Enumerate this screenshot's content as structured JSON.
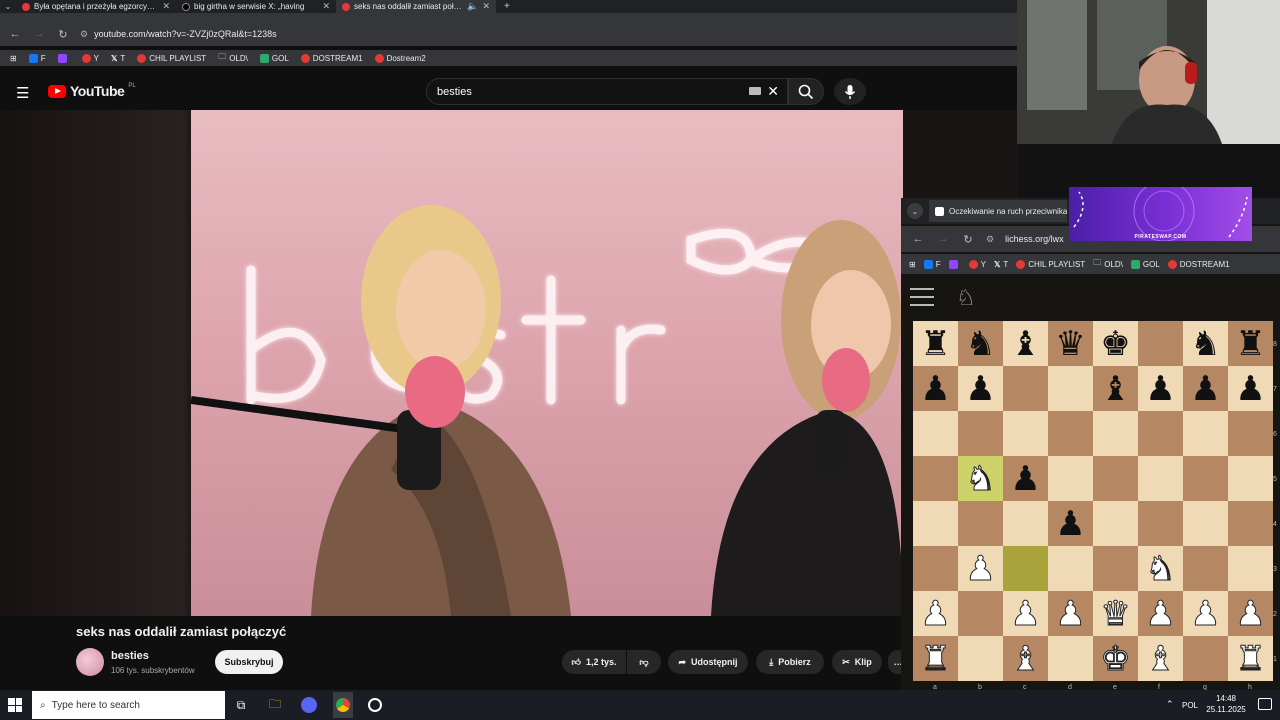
{
  "browser": {
    "tabs": [
      {
        "label": "Była opętana i przeżyła egzorcyzmy",
        "icon": "youtube-icon"
      },
      {
        "label": "big girtha w serwisie X: „having",
        "icon": "x-icon"
      },
      {
        "label": "seks nas oddalił zamiast połączyć",
        "icon": "youtube-icon",
        "active": true
      }
    ],
    "url": "youtube.com/watch?v=-ZVZj0zQRal&t=1238s",
    "bookmarks": [
      "F",
      "",
      "Y",
      "T",
      "CHIL PLAYLIST",
      "OLD\\",
      "GOL",
      "DOSTREAM1",
      "Dostream2"
    ]
  },
  "youtube": {
    "logo": "YouTube",
    "region": "PL",
    "search_value": "besties",
    "video_title": "seks nas oddalił zamiast połączyć",
    "channel_name": "besties",
    "channel_subs": "106 tys. subskrybentów",
    "subscribe_label": "Subskrybuj",
    "like_count": "1,2 tys.",
    "share_label": "Udostępnij",
    "download_label": "Pobierz",
    "clip_label": "Klip",
    "more_label": "…"
  },
  "lichess": {
    "tab_title": "Oczekiwanie na ruch przeciwnika",
    "url": "lichess.org/lwx",
    "bookmarks": [
      "F",
      "",
      "Y",
      "T",
      "CHIL PLAYLIST",
      "OLD\\",
      "GOL",
      "DOSTREAM1"
    ],
    "banner_text": "PIRATESWAP.COM",
    "ranks": [
      "8",
      "7",
      "6",
      "5",
      "4",
      "3",
      "2",
      "1"
    ],
    "files": [
      "a",
      "b",
      "c",
      "d",
      "e",
      "f",
      "g",
      "h"
    ],
    "board": [
      [
        "br",
        "bn",
        "bb",
        "bq",
        "bk",
        "",
        "bn",
        "br"
      ],
      [
        "bp",
        "bp",
        "",
        "",
        "bb",
        "bp",
        "bp",
        "bp"
      ],
      [
        "",
        "",
        "",
        "",
        "",
        "",
        "",
        ""
      ],
      [
        "",
        "wn",
        "bp",
        "",
        "",
        "",
        "",
        ""
      ],
      [
        "",
        "",
        "",
        "bp",
        "",
        "",
        "",
        ""
      ],
      [
        "",
        "wp",
        "",
        "",
        "",
        "wn",
        "",
        ""
      ],
      [
        "wp",
        "",
        "wp",
        "wp",
        "wq",
        "wp",
        "wp",
        "wp"
      ],
      [
        "wr",
        "",
        "wb",
        "",
        "wk",
        "wb",
        "",
        "wr"
      ]
    ],
    "highlights": [
      "b5",
      "c3"
    ]
  },
  "taskbar": {
    "search_placeholder": "Type here to search",
    "lang": "POL",
    "time": "14:48",
    "date": "25.11.2025"
  }
}
